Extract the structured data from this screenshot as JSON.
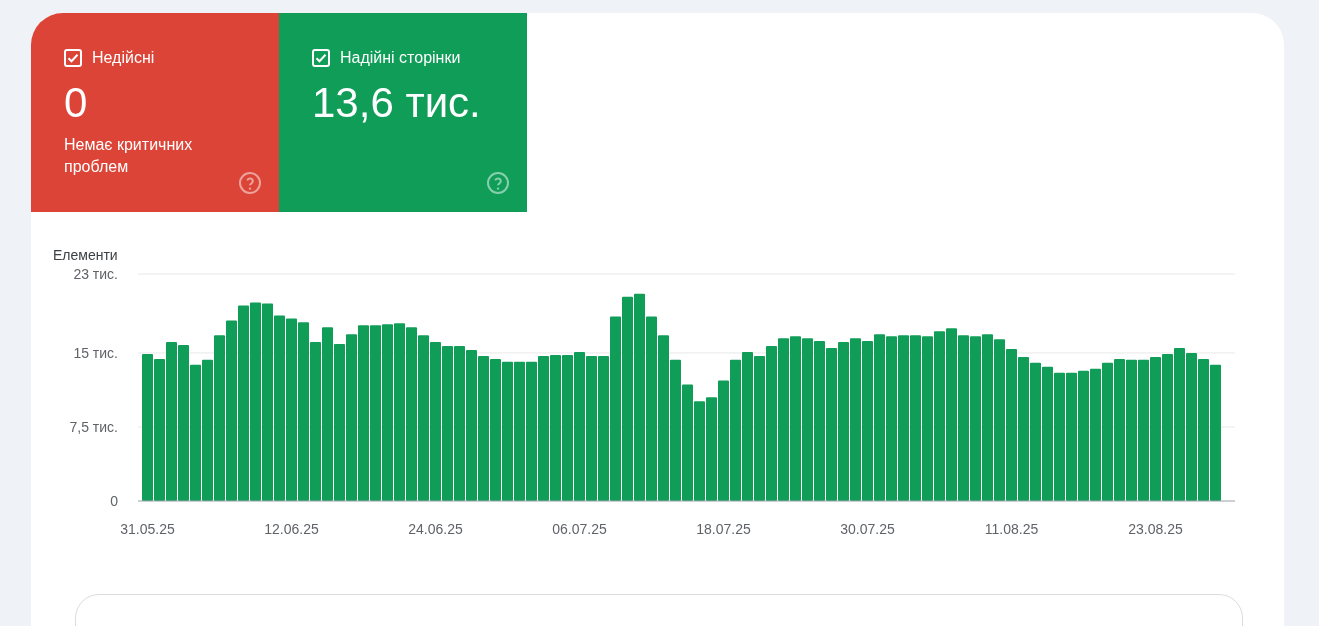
{
  "cards": [
    {
      "kind": "error",
      "label": "Недійсні",
      "checked": true,
      "value": "0",
      "note": "Немає критичних проблем"
    },
    {
      "kind": "valid",
      "label": "Надійні сторінки",
      "checked": true,
      "value": "13,6 тис."
    }
  ],
  "chart": {
    "chart_data": {
      "type": "bar",
      "ylabel": "Елементи",
      "ylim": [
        0,
        23
      ],
      "yticks": [
        {
          "value": 0,
          "label": "0"
        },
        {
          "value": 7.5,
          "label": "7,5 тис."
        },
        {
          "value": 15,
          "label": "15 тис."
        },
        {
          "value": 23,
          "label": "23 тис."
        }
      ],
      "categories": [
        "31.05.25",
        null,
        null,
        null,
        null,
        null,
        null,
        null,
        null,
        null,
        null,
        null,
        "12.06.25",
        null,
        null,
        null,
        null,
        null,
        null,
        null,
        null,
        null,
        null,
        null,
        "24.06.25",
        null,
        null,
        null,
        null,
        null,
        null,
        null,
        null,
        null,
        null,
        null,
        "06.07.25",
        null,
        null,
        null,
        null,
        null,
        null,
        null,
        null,
        null,
        null,
        null,
        "18.07.25",
        null,
        null,
        null,
        null,
        null,
        null,
        null,
        null,
        null,
        null,
        null,
        "30.07.25",
        null,
        null,
        null,
        null,
        null,
        null,
        null,
        null,
        null,
        null,
        null,
        "11.08.25",
        null,
        null,
        null,
        null,
        null,
        null,
        null,
        null,
        null,
        null,
        null,
        "23.08.25",
        null,
        null,
        null,
        null,
        null
      ],
      "series": [
        {
          "color": "#0f9d58",
          "values": [
            14.9,
            14.4,
            16.1,
            15.8,
            13.8,
            14.3,
            16.8,
            18.3,
            19.8,
            20.1,
            20.0,
            18.8,
            18.5,
            18.1,
            16.1,
            17.6,
            15.9,
            16.9,
            17.8,
            17.8,
            17.9,
            18.0,
            17.6,
            16.8,
            16.1,
            15.7,
            15.7,
            15.3,
            14.7,
            14.4,
            14.1,
            14.1,
            14.1,
            14.7,
            14.8,
            14.8,
            15.1,
            14.7,
            14.7,
            18.7,
            20.7,
            21.0,
            18.7,
            16.8,
            14.3,
            11.8,
            10.1,
            10.5,
            12.2,
            14.3,
            15.1,
            14.7,
            15.7,
            16.5,
            16.7,
            16.5,
            16.2,
            15.5,
            16.1,
            16.5,
            16.2,
            16.9,
            16.7,
            16.8,
            16.8,
            16.7,
            17.2,
            17.5,
            16.8,
            16.7,
            16.9,
            16.4,
            15.4,
            14.6,
            14.0,
            13.6,
            13.0,
            13.0,
            13.2,
            13.4,
            14.0,
            14.4,
            14.3,
            14.3,
            14.6,
            14.9,
            15.5,
            15.0,
            14.4,
            13.8
          ]
        }
      ]
    }
  }
}
